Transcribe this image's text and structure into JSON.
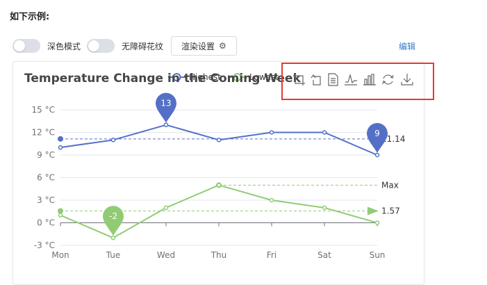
{
  "page": {
    "heading": "如下示例:",
    "controls": {
      "dark_mode_label": "深色模式",
      "accessible_pattern_label": "无障碍花纹",
      "render_settings_label": "渲染设置",
      "edit_label": "编辑"
    }
  },
  "chart_data": {
    "type": "line",
    "title": "Temperature Change in the Coming Week",
    "categories": [
      "Mon",
      "Tue",
      "Wed",
      "Thu",
      "Fri",
      "Sat",
      "Sun"
    ],
    "series": [
      {
        "name": "Highest",
        "color": "#5470c6",
        "values": [
          10,
          11,
          13,
          11,
          12,
          12,
          9
        ],
        "mark_points": [
          {
            "label": "13",
            "category": "Wed",
            "value": 13
          },
          {
            "label": "9",
            "category": "Sun",
            "value": 9
          }
        ],
        "mark_line": {
          "label": "11.14",
          "value": 11.14,
          "kind": "average"
        }
      },
      {
        "name": "Lowest",
        "color": "#91cc75",
        "values": [
          1,
          -2,
          2,
          5,
          3,
          2,
          0
        ],
        "mark_points": [
          {
            "label": "-2",
            "category": "Tue",
            "value": -2
          }
        ],
        "mark_lines": [
          {
            "label": "1.57",
            "value": 1.57,
            "kind": "average"
          },
          {
            "label": "Max",
            "value": 5,
            "kind": "max",
            "from_category": "Thu"
          }
        ]
      }
    ],
    "y_axis": {
      "min": -3,
      "max": 15,
      "interval": 3,
      "tick_labels": [
        "-3 °C",
        "0 °C",
        "3 °C",
        "6 °C",
        "9 °C",
        "12 °C",
        "15 °C"
      ]
    },
    "legend_position": "top",
    "grid": true
  },
  "toolbox": {
    "icons": [
      "zoom-icon",
      "zoom-reset-icon",
      "data-view-icon",
      "line-chart-icon",
      "bar-chart-icon",
      "restore-icon",
      "save-image-icon"
    ]
  }
}
